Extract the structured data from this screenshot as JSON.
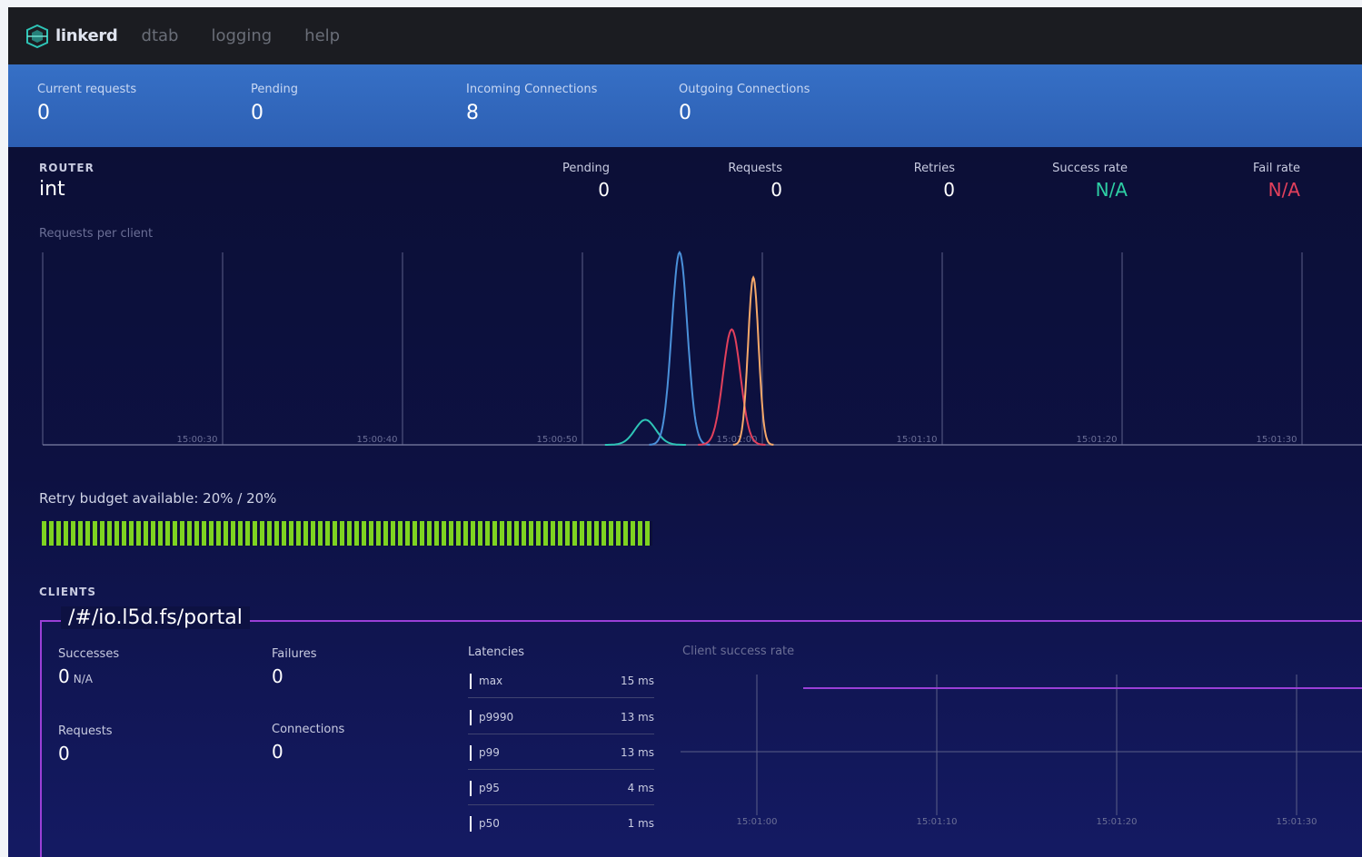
{
  "nav": {
    "brand": "linkerd",
    "links": [
      "dtab",
      "logging",
      "help"
    ]
  },
  "summary": [
    {
      "label": "Current requests",
      "value": "0"
    },
    {
      "label": "Pending",
      "value": "0"
    },
    {
      "label": "Incoming Connections",
      "value": "8"
    },
    {
      "label": "Outgoing Connections",
      "value": "0"
    }
  ],
  "router": {
    "section_label": "ROUTER",
    "name": "int",
    "stats": {
      "pending": {
        "label": "Pending",
        "value": "0"
      },
      "requests": {
        "label": "Requests",
        "value": "0"
      },
      "retries": {
        "label": "Retries",
        "value": "0"
      },
      "success_rate": {
        "label": "Success rate",
        "value": "N/A"
      },
      "fail_rate": {
        "label": "Fail rate",
        "value": "N/A"
      }
    },
    "chart_label": "Requests per client"
  },
  "chart_data": [
    {
      "type": "line",
      "title": "Requests per client",
      "x": [
        "15:00:30",
        "15:00:40",
        "15:00:50",
        "15:01:00",
        "15:01:10",
        "15:01:20",
        "15:01:30"
      ],
      "series": [
        {
          "color": "#2ec4b6",
          "peak_x": 3.35,
          "peak_y": 0.13,
          "width": 0.12
        },
        {
          "color": "#4a90d9",
          "peak_x": 3.54,
          "peak_y": 1.0,
          "width": 0.09
        },
        {
          "color": "#e2405c",
          "peak_x": 3.83,
          "peak_y": 0.6,
          "width": 0.1
        },
        {
          "color": "#f5a86a",
          "peak_x": 3.95,
          "peak_y": 0.87,
          "width": 0.06
        }
      ],
      "ylim": [
        0,
        1
      ]
    },
    {
      "type": "line",
      "title": "Client success rate",
      "x": [
        "15:01:00",
        "15:01:10",
        "15:01:20",
        "15:01:30"
      ],
      "series": [
        {
          "color": "#9a3fd6",
          "values": [
            1,
            1,
            1,
            1
          ]
        }
      ]
    }
  ],
  "retry": {
    "label": "Retry budget available: 20% / 20%",
    "fraction": 1.0
  },
  "clients": {
    "section_label": "CLIENTS",
    "name": "/#/io.l5d.fs/portal",
    "successes": {
      "label": "Successes",
      "value": "0",
      "unit": "N/A"
    },
    "failures": {
      "label": "Failures",
      "value": "0"
    },
    "requests": {
      "label": "Requests",
      "value": "0"
    },
    "connections": {
      "label": "Connections",
      "value": "0"
    },
    "latencies": {
      "title": "Latencies",
      "rows": [
        {
          "name": "max",
          "value": "15 ms"
        },
        {
          "name": "p9990",
          "value": "13 ms"
        },
        {
          "name": "p99",
          "value": "13 ms"
        },
        {
          "name": "p95",
          "value": "4 ms"
        },
        {
          "name": "p50",
          "value": "1 ms"
        }
      ]
    },
    "success_chart_label": "Client success rate"
  },
  "colors": {
    "nav_bg": "#1b1c21",
    "summary_bg": "#3670c6",
    "success": "#2ecfa4",
    "failure": "#e2405c",
    "retry_bar": "#7ed321",
    "client_accent": "#9a3fd6"
  }
}
